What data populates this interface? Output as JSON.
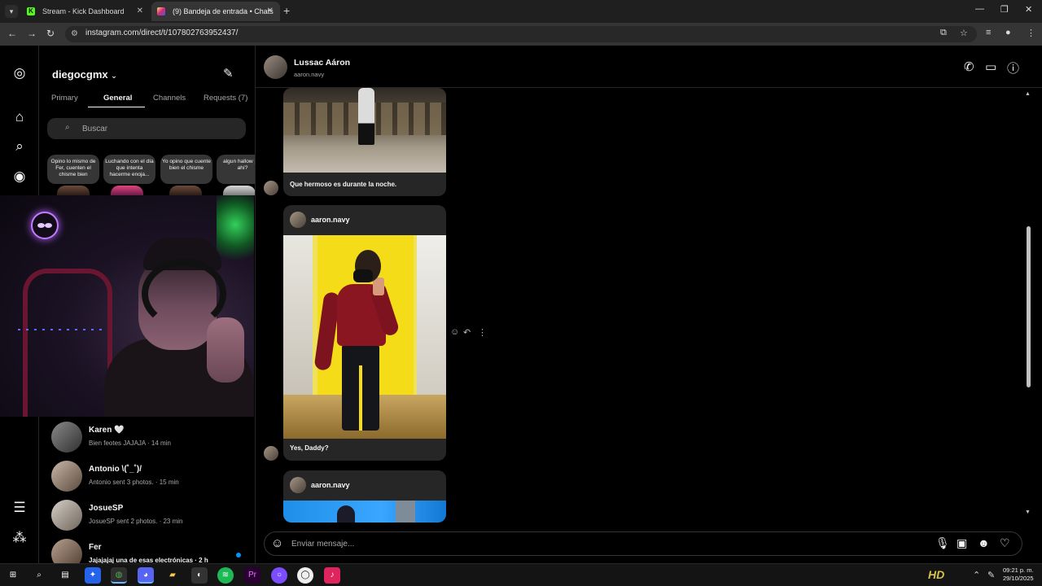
{
  "browser": {
    "tabs": [
      {
        "label": "Stream - Kick Dashboard",
        "favicon": "kick-icon"
      },
      {
        "label": "(9) Bandeja de entrada • Chats",
        "favicon": "instagram-icon"
      }
    ],
    "url": "instagram.com/direct/t/107802763952437/"
  },
  "inbox": {
    "username": "diegocgmx",
    "tabs": [
      "Primary",
      "General",
      "Channels",
      "Requests (7)"
    ],
    "active_tab": "General",
    "search_placeholder": "Buscar",
    "notes": [
      "Opino lo mismo de Fer, cuenten el chisme bien",
      "Luchando con el día que intenta hacerme enoja...",
      "Yo opino que cuente bien el chisme",
      "algun hallow por ahí?"
    ],
    "chats": [
      {
        "name": "Karen 🤍",
        "preview": "Bien feotes JAJAJA · 14 min",
        "unread": false
      },
      {
        "name": "Antonio \\(˚_˚)/",
        "preview": "Antonio sent 3 photos. · 15 min",
        "unread": false
      },
      {
        "name": "JosueSP",
        "preview": "JosueSP sent 2 photos. · 23 min",
        "unread": false
      },
      {
        "name": "Fer",
        "preview": "Jajajajaj una de esas electrónicas · 2 h",
        "unread": true
      }
    ]
  },
  "conversation": {
    "name": "Lussac Aáron",
    "handle": "aaron.navy",
    "messages": [
      {
        "caption": "Que hermoso es durante la noche."
      },
      {
        "shared_from": "aaron.navy",
        "caption": "Yes, Daddy?"
      },
      {
        "shared_from": "aaron.navy"
      }
    ],
    "composer_placeholder": "Enviar mensaje..."
  },
  "taskbar": {
    "time": "09:21 p. m.",
    "date": "29/10/2025"
  }
}
